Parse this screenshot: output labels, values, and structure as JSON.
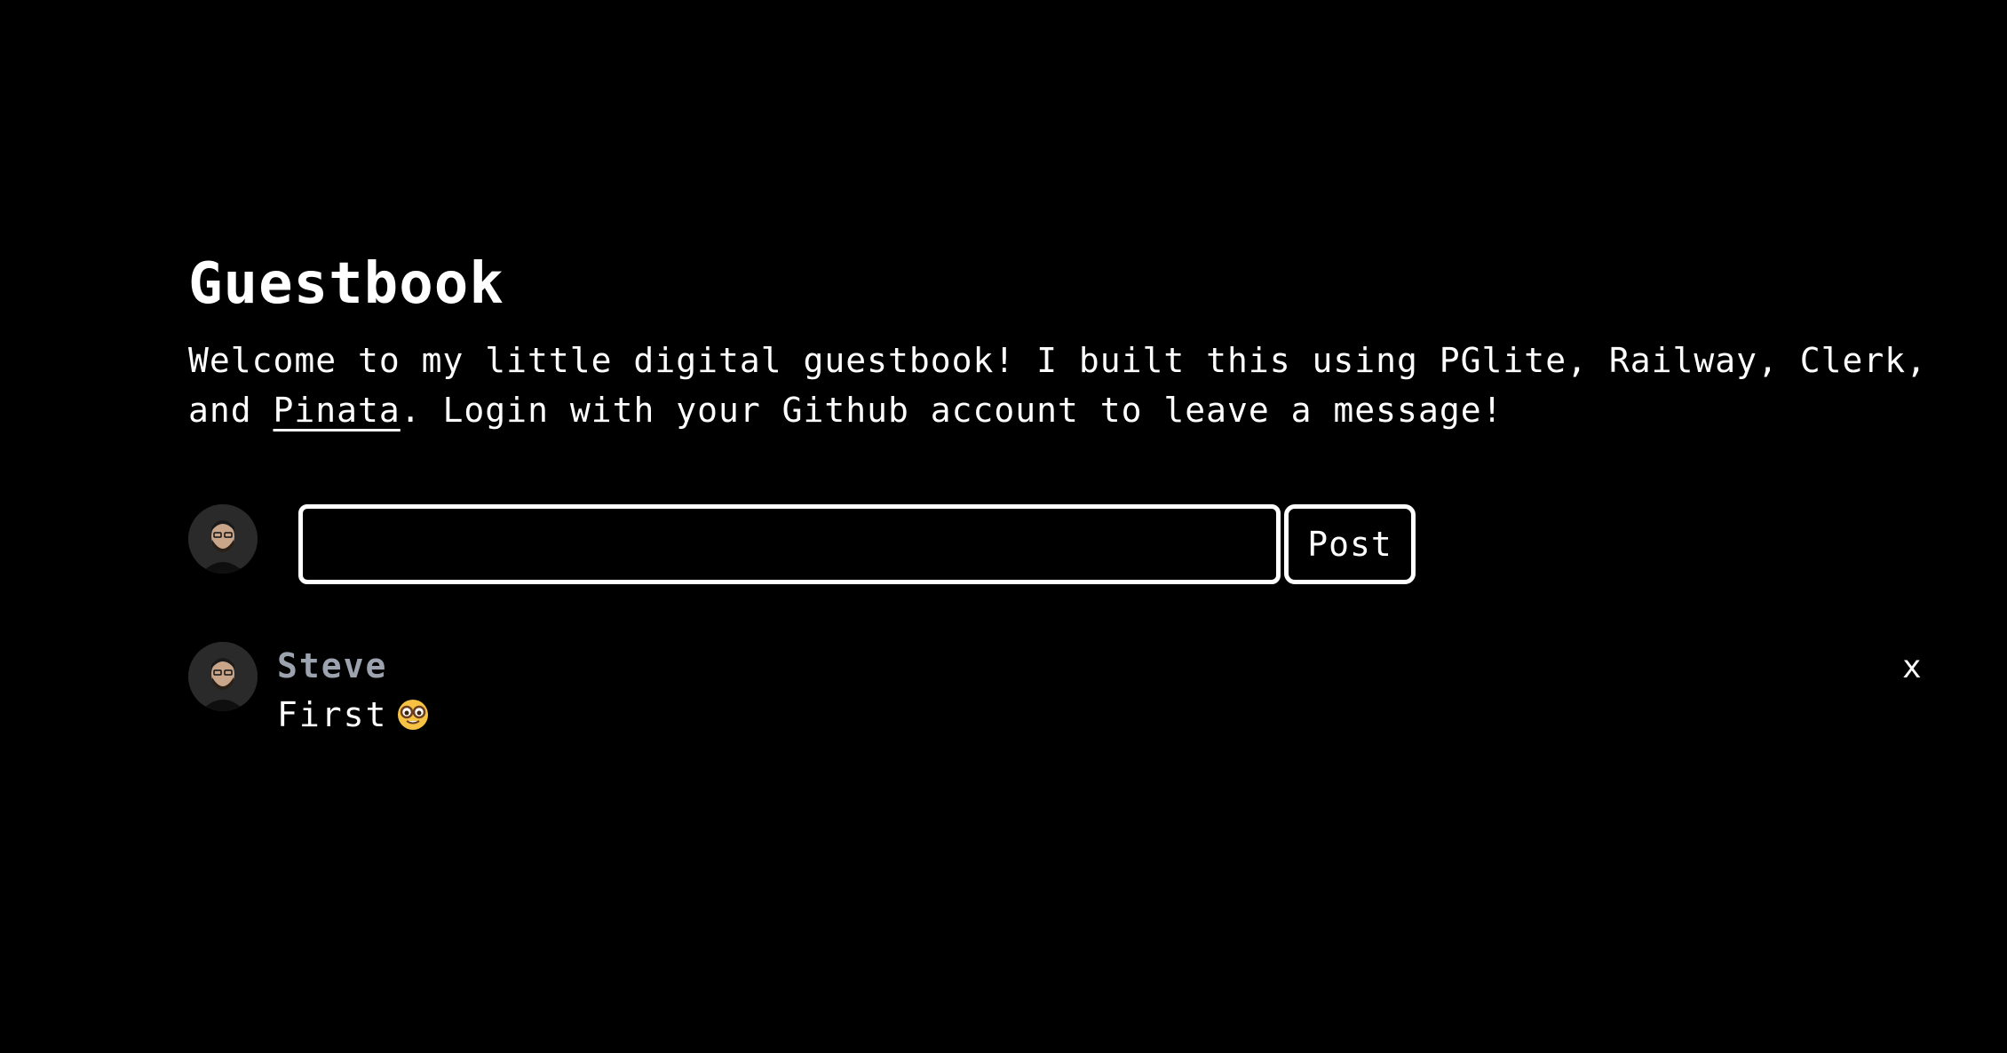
{
  "page": {
    "title": "Guestbook",
    "intro_before_link": "Welcome to my little digital guestbook! I built this using PGlite, Railway, Clerk, and ",
    "intro_link": "Pinata",
    "intro_after_link": ". Login with your Github account to leave a message!"
  },
  "composer": {
    "input_value": "",
    "input_placeholder": "",
    "post_label": "Post"
  },
  "entries": [
    {
      "name": "Steve",
      "message": "First",
      "emoji": "nerd-face-icon",
      "delete_label": "x"
    }
  ],
  "colors": {
    "background": "#000000",
    "text": "#ffffff",
    "name": "#9ca3af"
  }
}
